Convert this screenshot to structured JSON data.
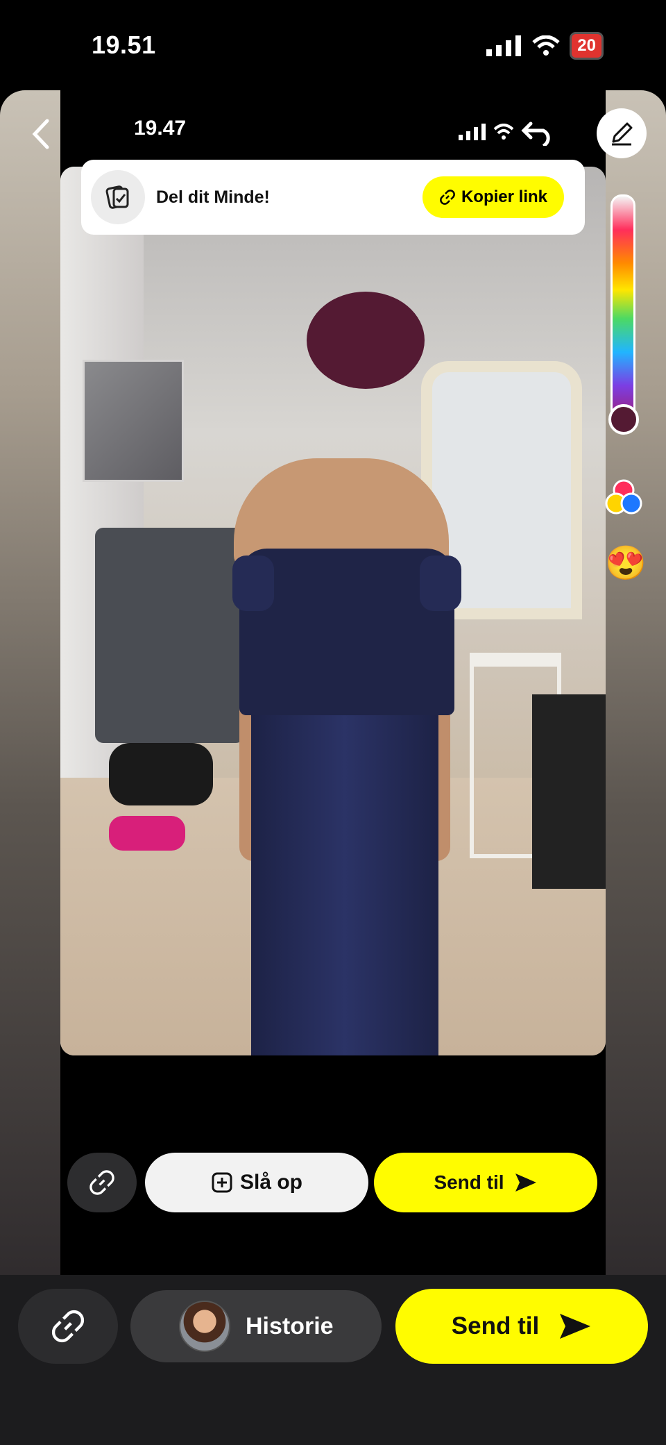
{
  "status_bar": {
    "time": "19.51",
    "battery": "20"
  },
  "inner": {
    "status_bar": {
      "time": "19.47"
    },
    "banner": {
      "text": "Del dit Minde!",
      "button": "Kopier link"
    },
    "actions": {
      "slaop_label": "Slå op",
      "send_label": "Send til"
    }
  },
  "editor": {
    "emoji": "😍",
    "selected_color": "#541a33"
  },
  "bottom": {
    "story_label": "Historie",
    "send_label": "Send til"
  },
  "colors": {
    "snap_yellow": "#fffc00"
  }
}
